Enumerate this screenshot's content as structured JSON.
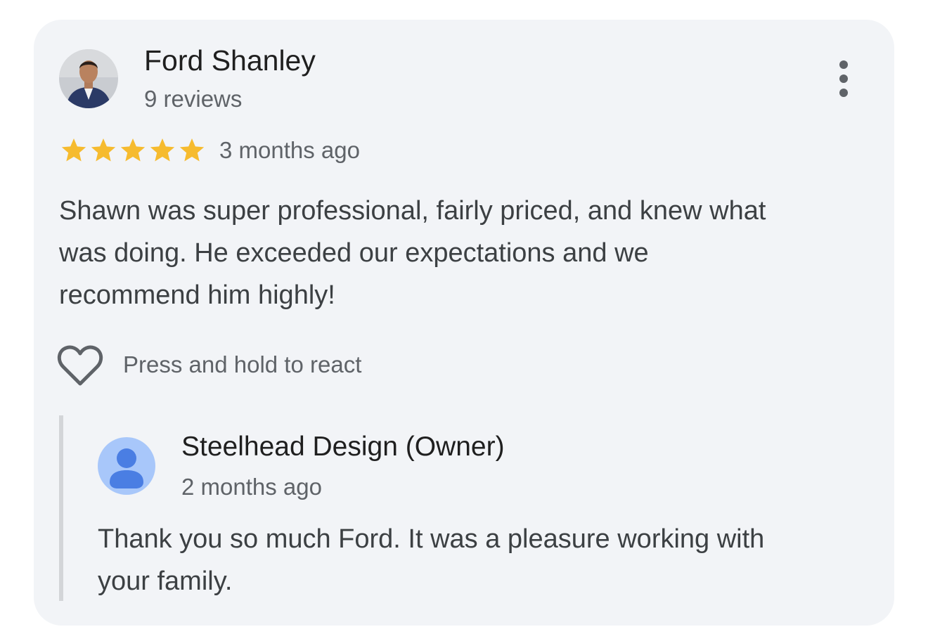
{
  "review": {
    "reviewer_name": "Ford Shanley",
    "review_count": "9 reviews",
    "rating": 5,
    "rating_max": 5,
    "time_ago": "3 months ago",
    "text_lines": [
      "Shawn was super professional, fairly priced, and knew what",
      "was doing. He exceeded our expectations and we",
      "recommend him highly!"
    ],
    "react_label": "Press and hold to react"
  },
  "owner_reply": {
    "name": "Steelhead Design (Owner)",
    "time_ago": "2 months ago",
    "text_lines": [
      "Thank you so much Ford. It was a pleasure working with",
      "your family."
    ]
  },
  "icons": {
    "menu": "more-vert-icon",
    "star": "star-icon",
    "heart": "heart-outline-icon",
    "owner_avatar": "default-person-icon"
  },
  "colors": {
    "card_background": "#f2f4f7",
    "star": "#f6bb2f",
    "owner_avatar_bg": "#a8c7fa",
    "owner_avatar_fg": "#4a7ee3",
    "reply_bar": "#d3d5d8",
    "primary_text": "#1f1f1f",
    "secondary_text": "#5f6368"
  }
}
